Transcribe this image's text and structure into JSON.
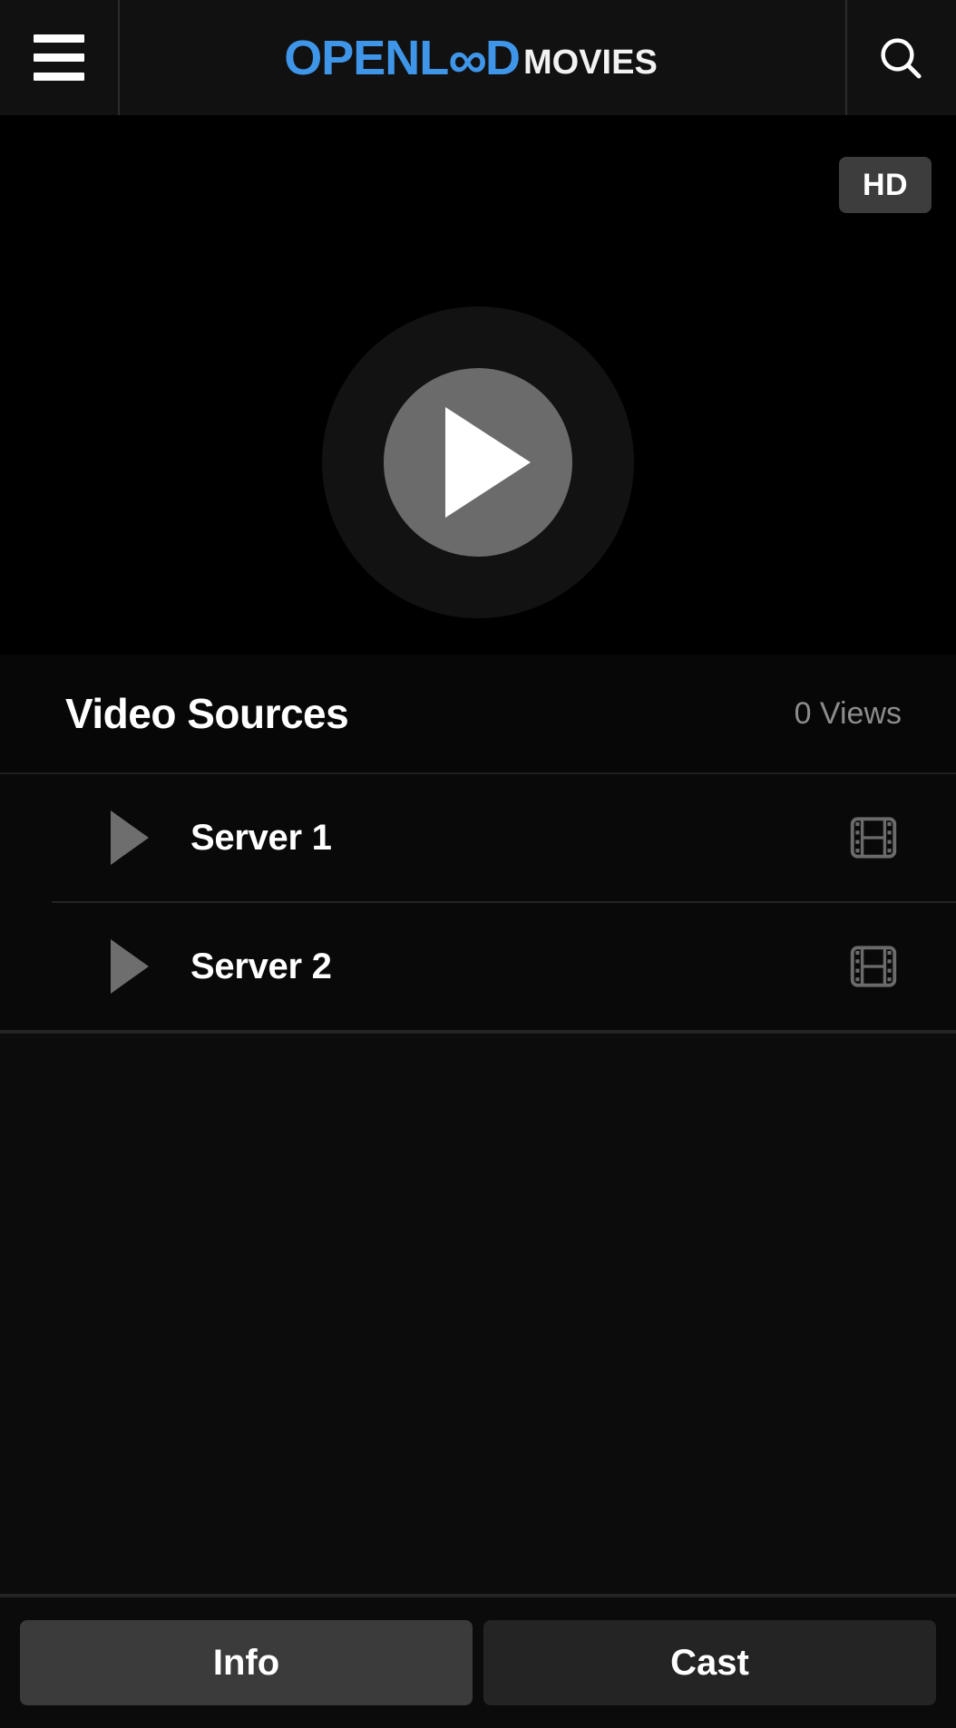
{
  "header": {
    "menu_icon": "hamburger-menu-icon",
    "brand": {
      "part1": "OPENL",
      "infinity": "∞",
      "part2": "D",
      "suffix": "MOVIES",
      "accent_color": "#3f95e8"
    },
    "search_icon": "search-icon"
  },
  "player": {
    "quality_badge": "HD",
    "play_icon": "play-icon",
    "seek_progress_percent": 0,
    "background_color": "#000000"
  },
  "sources": {
    "title": "Video Sources",
    "views": "0 Views",
    "rows": [
      {
        "label": "Server 1",
        "play_icon": "play-icon",
        "media_icon": "film-strip-icon"
      },
      {
        "label": "Server 2",
        "play_icon": "play-icon",
        "media_icon": "film-strip-icon"
      }
    ]
  },
  "bottombar": {
    "info_label": "Info",
    "cast_label": "Cast",
    "info_color": "#3b3b3b",
    "cast_color": "#242424"
  }
}
